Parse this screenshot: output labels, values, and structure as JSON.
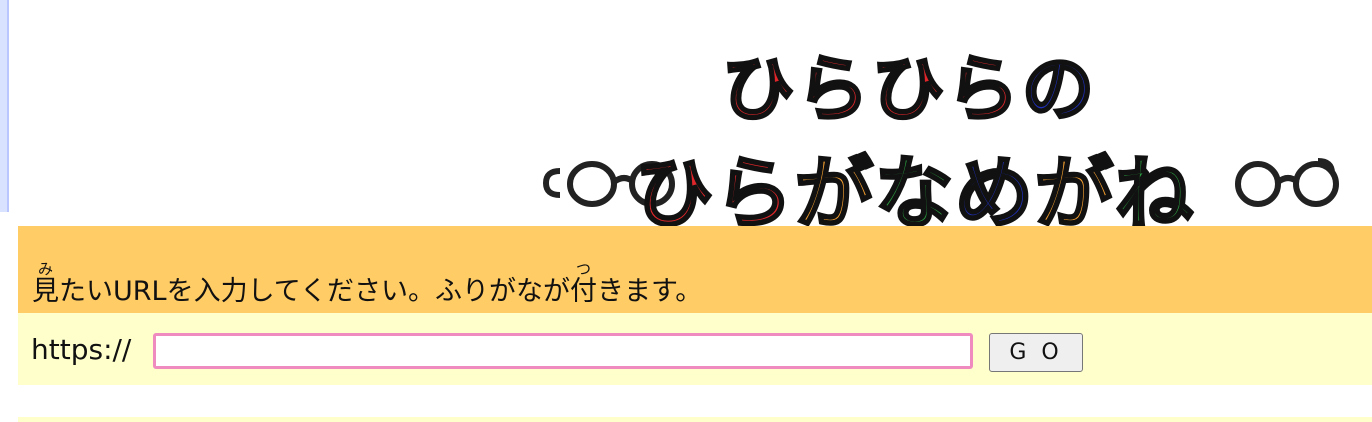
{
  "logo": {
    "line1": "ひらひらの",
    "line2": "ひらがなめがね",
    "icon": "eyeglasses-icon"
  },
  "instruction": {
    "part1_base": "見",
    "part1_ruby": "み",
    "part2": "たいURLを入力してください。ふりがなが",
    "part3_base": "付",
    "part3_ruby": "つ",
    "part4": "きます。"
  },
  "form": {
    "scheme": "https://",
    "url_value": "",
    "go_label": "G O"
  },
  "colors": {
    "instruction_bg": "#ffcc66",
    "form_bg": "#ffffcc",
    "input_border": "#f08bc0",
    "logo_red": "#e0262a",
    "logo_blue": "#1f2fb8",
    "logo_orange": "#f5a031",
    "logo_green": "#2a9a3e"
  }
}
